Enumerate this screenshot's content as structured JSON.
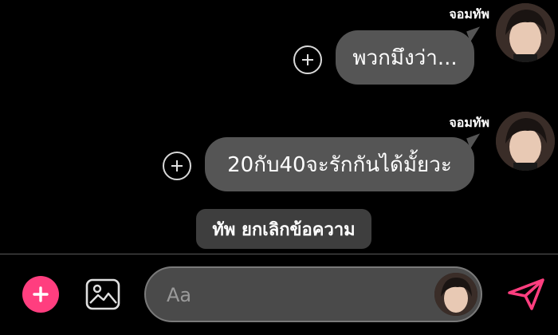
{
  "messages": [
    {
      "sender": "จอมทัพ",
      "text": "พวกมึงว่า..."
    },
    {
      "sender": "จอมทัพ",
      "text": "20กับ40จะรักกันได้มั้ยวะ"
    }
  ],
  "system_message": "ทัพ ยกเลิกข้อความ",
  "composer": {
    "placeholder": "Aa"
  },
  "colors": {
    "accent": "#ff3e7f",
    "bubble": "#555555",
    "background": "#000000"
  }
}
